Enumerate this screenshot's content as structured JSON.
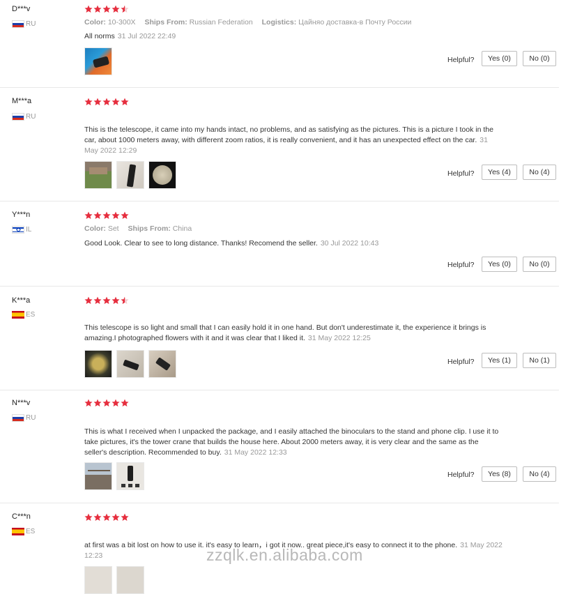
{
  "helpful_label": "Helpful?",
  "star_color": "#e62e3e",
  "reviews": [
    {
      "name": "D***v",
      "country": "RU",
      "rating": 4.5,
      "meta": [
        {
          "label": "Color:",
          "value": "10-300X"
        },
        {
          "label": "Ships From:",
          "value": "Russian Federation"
        },
        {
          "label": "Logistics:",
          "value": "Цайняо доставка-в Почту России"
        }
      ],
      "text": "All norms",
      "date": "31 Jul 2022 22:49",
      "yes": "Yes (0)",
      "no": "No (0)"
    },
    {
      "name": "M***a",
      "country": "RU",
      "rating": 5,
      "text": "This is the telescope, it came into my hands intact, no problems, and as satisfying as the pictures. This is a picture I took in the car, about 1000 meters away, with different zoom ratios, it is really convenient, and it has an unexpected effect on the car.",
      "date": "31 May 2022 12:29",
      "yes": "Yes (4)",
      "no": "No (4)"
    },
    {
      "name": "Y***n",
      "country": "IL",
      "rating": 5,
      "meta": [
        {
          "label": "Color:",
          "value": "Set"
        },
        {
          "label": "Ships From:",
          "value": "China"
        }
      ],
      "text": "Good Look. Clear to see to long distance. Thanks! Recomend the seller.",
      "date": "30 Jul 2022 10:43",
      "yes": "Yes (0)",
      "no": "No (0)"
    },
    {
      "name": "K***a",
      "country": "ES",
      "rating": 4.5,
      "text": "This telescope is so light and small that I can easily hold it in one hand. But don't underestimate it, the experience it brings is amazing.I photographed flowers with it and it was clear that I liked it.",
      "date": "31 May 2022 12:25",
      "yes": "Yes (1)",
      "no": "No (1)"
    },
    {
      "name": "N***v",
      "country": "RU",
      "rating": 5,
      "text": "This is what I received when I unpacked the package, and I easily attached the binoculars to the stand and phone clip. I use it to take pictures, it's the tower crane that builds the house here. About 2000 meters away, it is very clear and the same as the seller's description. Recommended to buy.",
      "date": "31 May 2022 12:33",
      "yes": "Yes (8)",
      "no": "No (4)"
    },
    {
      "name": "C***n",
      "country": "ES",
      "rating": 5,
      "text": "at first was a bit lost on how to use it. it's easy to learn，i got it now.. great piece,it's easy to connect it to the phone.",
      "date": "31 May 2022 12:23"
    }
  ],
  "watermark": "zzqlk.en.alibaba.com"
}
